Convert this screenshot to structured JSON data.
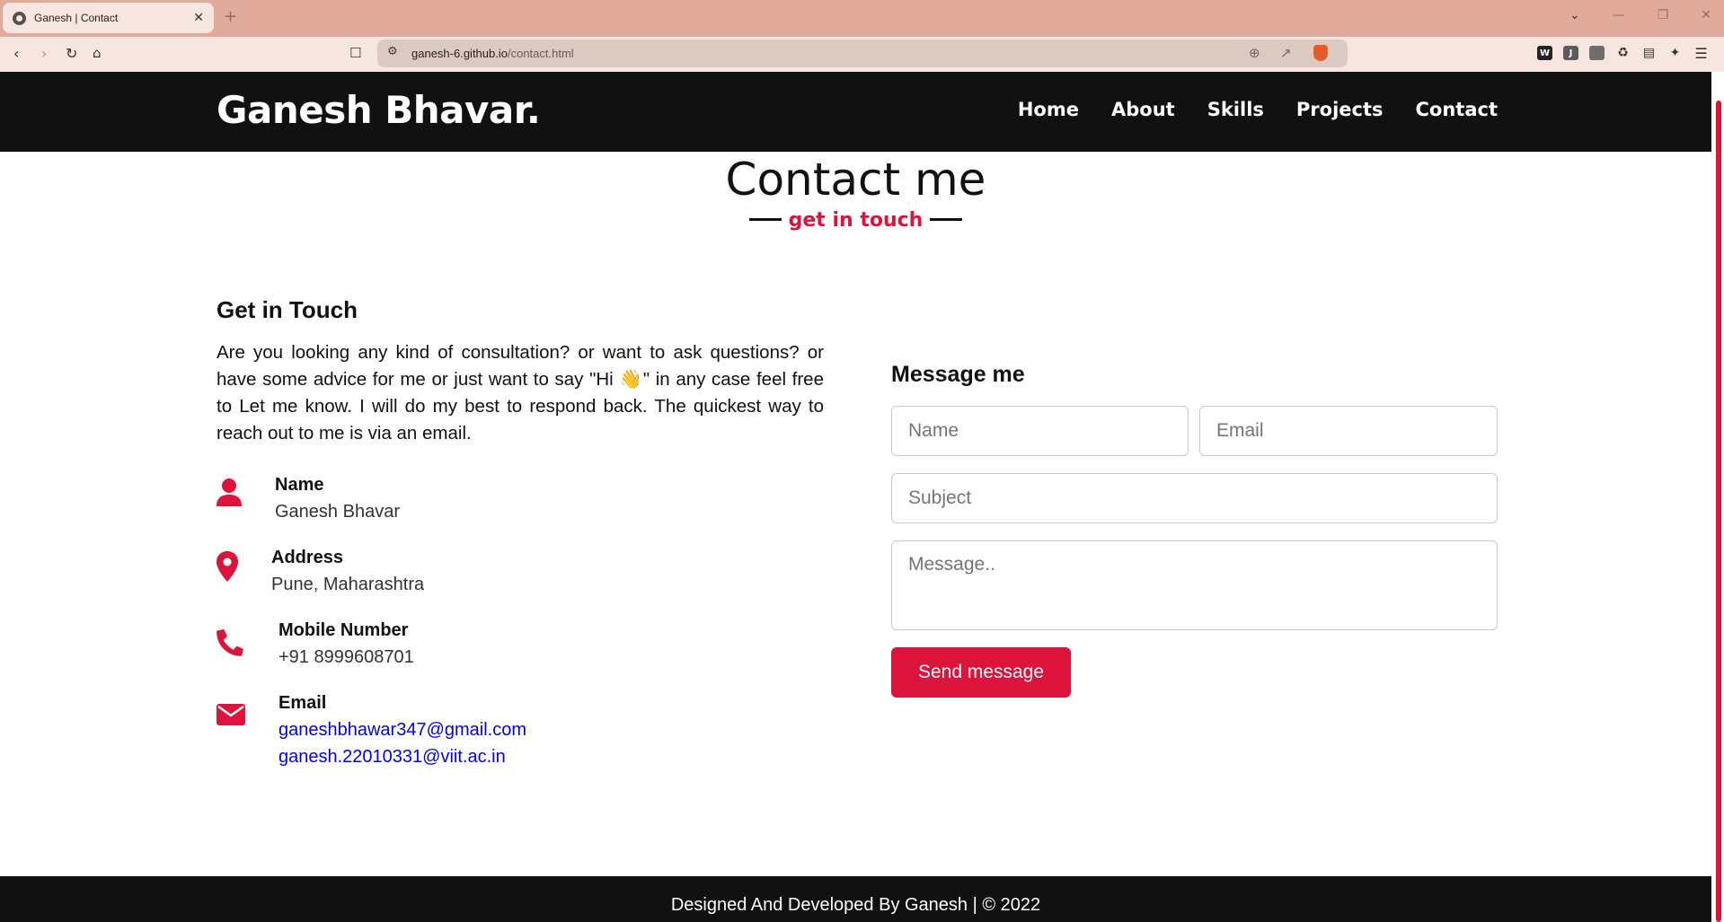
{
  "browser": {
    "tab_title": "Ganesh | Contact",
    "tab_close": "✕",
    "new_tab": "+",
    "url_host": "ganesh-6.github.io",
    "url_path": "/contact.html",
    "window_controls": [
      "⌄",
      "—",
      "❐",
      "✕"
    ],
    "extensions": [
      {
        "label": "W",
        "color": "#222222"
      },
      {
        "label": "J",
        "color": "#5b5b5b"
      },
      {
        "label": "",
        "color": "#6e6e6e"
      }
    ]
  },
  "navbar": {
    "brand": "Ganesh Bhavar.",
    "menu": [
      "Home",
      "About",
      "Skills",
      "Projects",
      "Contact"
    ]
  },
  "section": {
    "title": "Contact me",
    "subtitle": "get in touch"
  },
  "get_in_touch": {
    "title": "Get in Touch",
    "text": "Are you looking any kind of consultation? or want to ask questions? or have some advice for me or just want to say \"Hi 👋\" in any case feel free to Let me know. I will do my best to respond back. The quickest way to reach out to me is via an email."
  },
  "info": {
    "name_label": "Name",
    "name_value": "Ganesh Bhavar",
    "address_label": "Address",
    "address_value": "Pune, Maharashtra",
    "mobile_label": "Mobile Number",
    "mobile_value": "+91 8999608701",
    "email_label": "Email",
    "email_1": "ganeshbhawar347@gmail.com",
    "email_2": "ganesh.22010331@viit.ac.in"
  },
  "form": {
    "title": "Message me",
    "name_placeholder": "Name",
    "email_placeholder": "Email",
    "subject_placeholder": "Subject",
    "message_placeholder": "Message..",
    "send_label": "Send message"
  },
  "footer": {
    "text": "Designed And Developed By Ganesh | © 2022"
  },
  "colors": {
    "accent": "#dc143c",
    "dark": "#111111",
    "link": "#0000ee",
    "chrome_tabbar": "#e2aa9a",
    "chrome_toolbar": "#f7e6e0"
  }
}
